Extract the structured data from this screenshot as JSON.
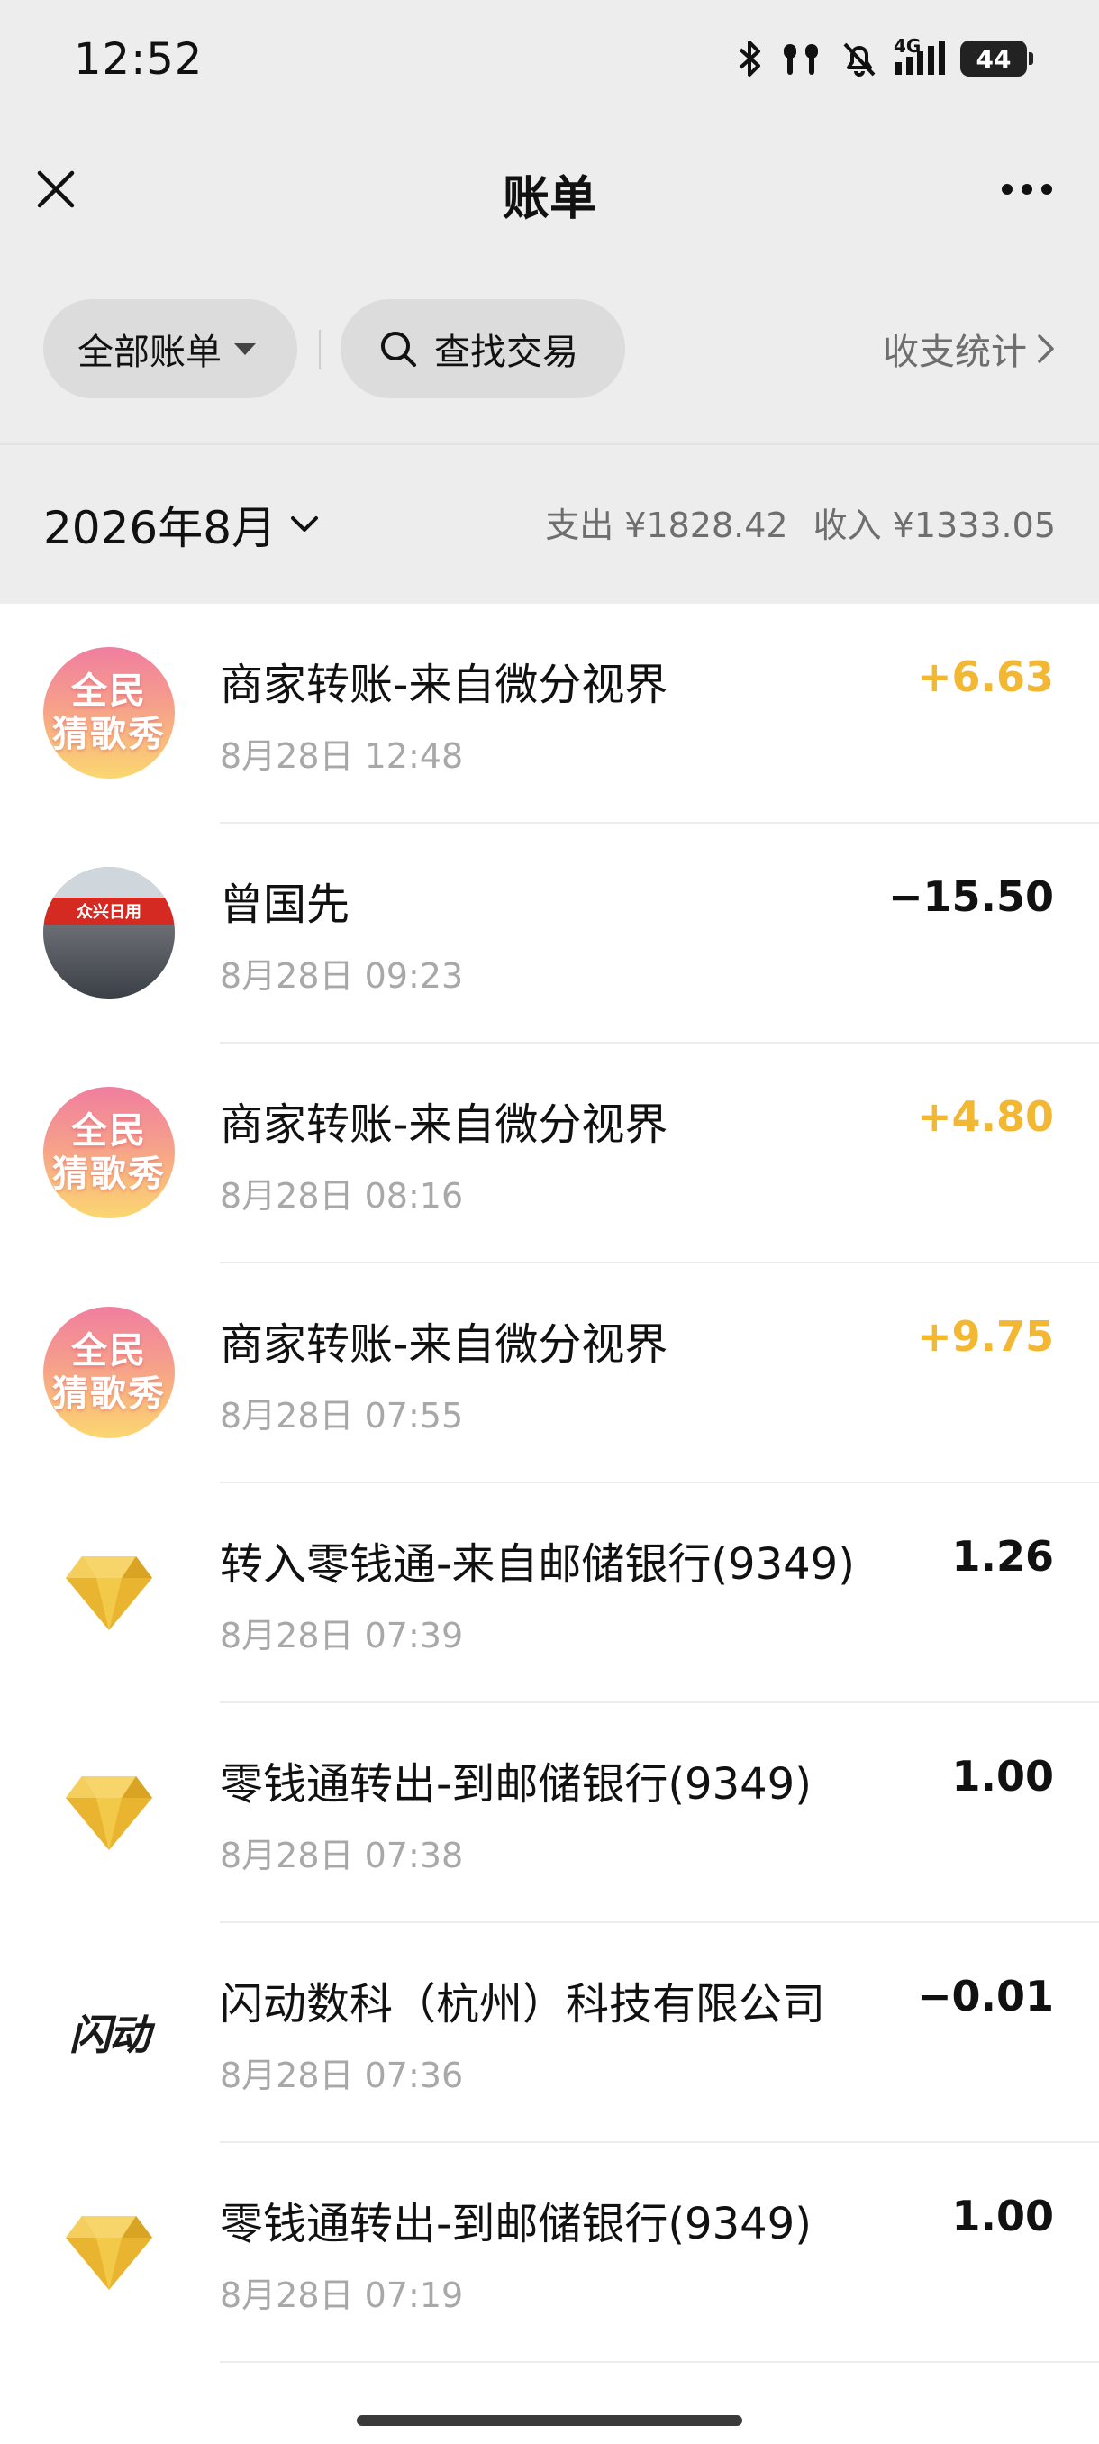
{
  "status_bar": {
    "time": "12:52",
    "network": "4G",
    "battery": "44",
    "icons": [
      "bluetooth-icon",
      "earbuds-icon",
      "mute-bell-icon",
      "signal-icon",
      "battery-icon"
    ]
  },
  "nav": {
    "title": "账单",
    "close_icon": "close-icon",
    "more_icon": "more-icon"
  },
  "filters": {
    "all_bills_label": "全部账单",
    "search_label": "查找交易",
    "stats_label": "收支统计"
  },
  "month": {
    "label": "2026年8月",
    "expense": "支出 ¥1828.42",
    "income": "收入 ¥1333.05"
  },
  "colors": {
    "income": "#f2b733",
    "expense": "#111111",
    "secondary_text": "#a8a8a8",
    "header_bg": "#ededed"
  },
  "transactions": [
    {
      "title": "商家转账-来自微分视界",
      "time": "8月28日 12:48",
      "amount": "+6.63",
      "type": "income",
      "avatar": "song-avatar",
      "avatar_text": [
        "全民",
        "猜歌秀"
      ]
    },
    {
      "title": "曾国先",
      "time": "8月28日 09:23",
      "amount": "−15.50",
      "type": "expense",
      "avatar": "photo-avatar",
      "avatar_text": [
        "众兴日用"
      ]
    },
    {
      "title": "商家转账-来自微分视界",
      "time": "8月28日 08:16",
      "amount": "+4.80",
      "type": "income",
      "avatar": "song-avatar",
      "avatar_text": [
        "全民",
        "猜歌秀"
      ]
    },
    {
      "title": "商家转账-来自微分视界",
      "time": "8月28日 07:55",
      "amount": "+9.75",
      "type": "income",
      "avatar": "song-avatar",
      "avatar_text": [
        "全民",
        "猜歌秀"
      ]
    },
    {
      "title": "转入零钱通-来自邮储银行(9349)",
      "time": "8月28日 07:39",
      "amount": "1.26",
      "type": "neutral",
      "avatar": "diamond-icon",
      "avatar_text": []
    },
    {
      "title": "零钱通转出-到邮储银行(9349)",
      "time": "8月28日 07:38",
      "amount": "1.00",
      "type": "neutral",
      "avatar": "diamond-icon",
      "avatar_text": []
    },
    {
      "title": "闪动数科（杭州）科技有限公司",
      "time": "8月28日 07:36",
      "amount": "−0.01",
      "type": "expense",
      "avatar": "flash-logo",
      "avatar_text": [
        "闪动"
      ]
    },
    {
      "title": "零钱通转出-到邮储银行(9349)",
      "time": "8月28日 07:19",
      "amount": "1.00",
      "type": "neutral",
      "avatar": "diamond-icon",
      "avatar_text": []
    }
  ]
}
